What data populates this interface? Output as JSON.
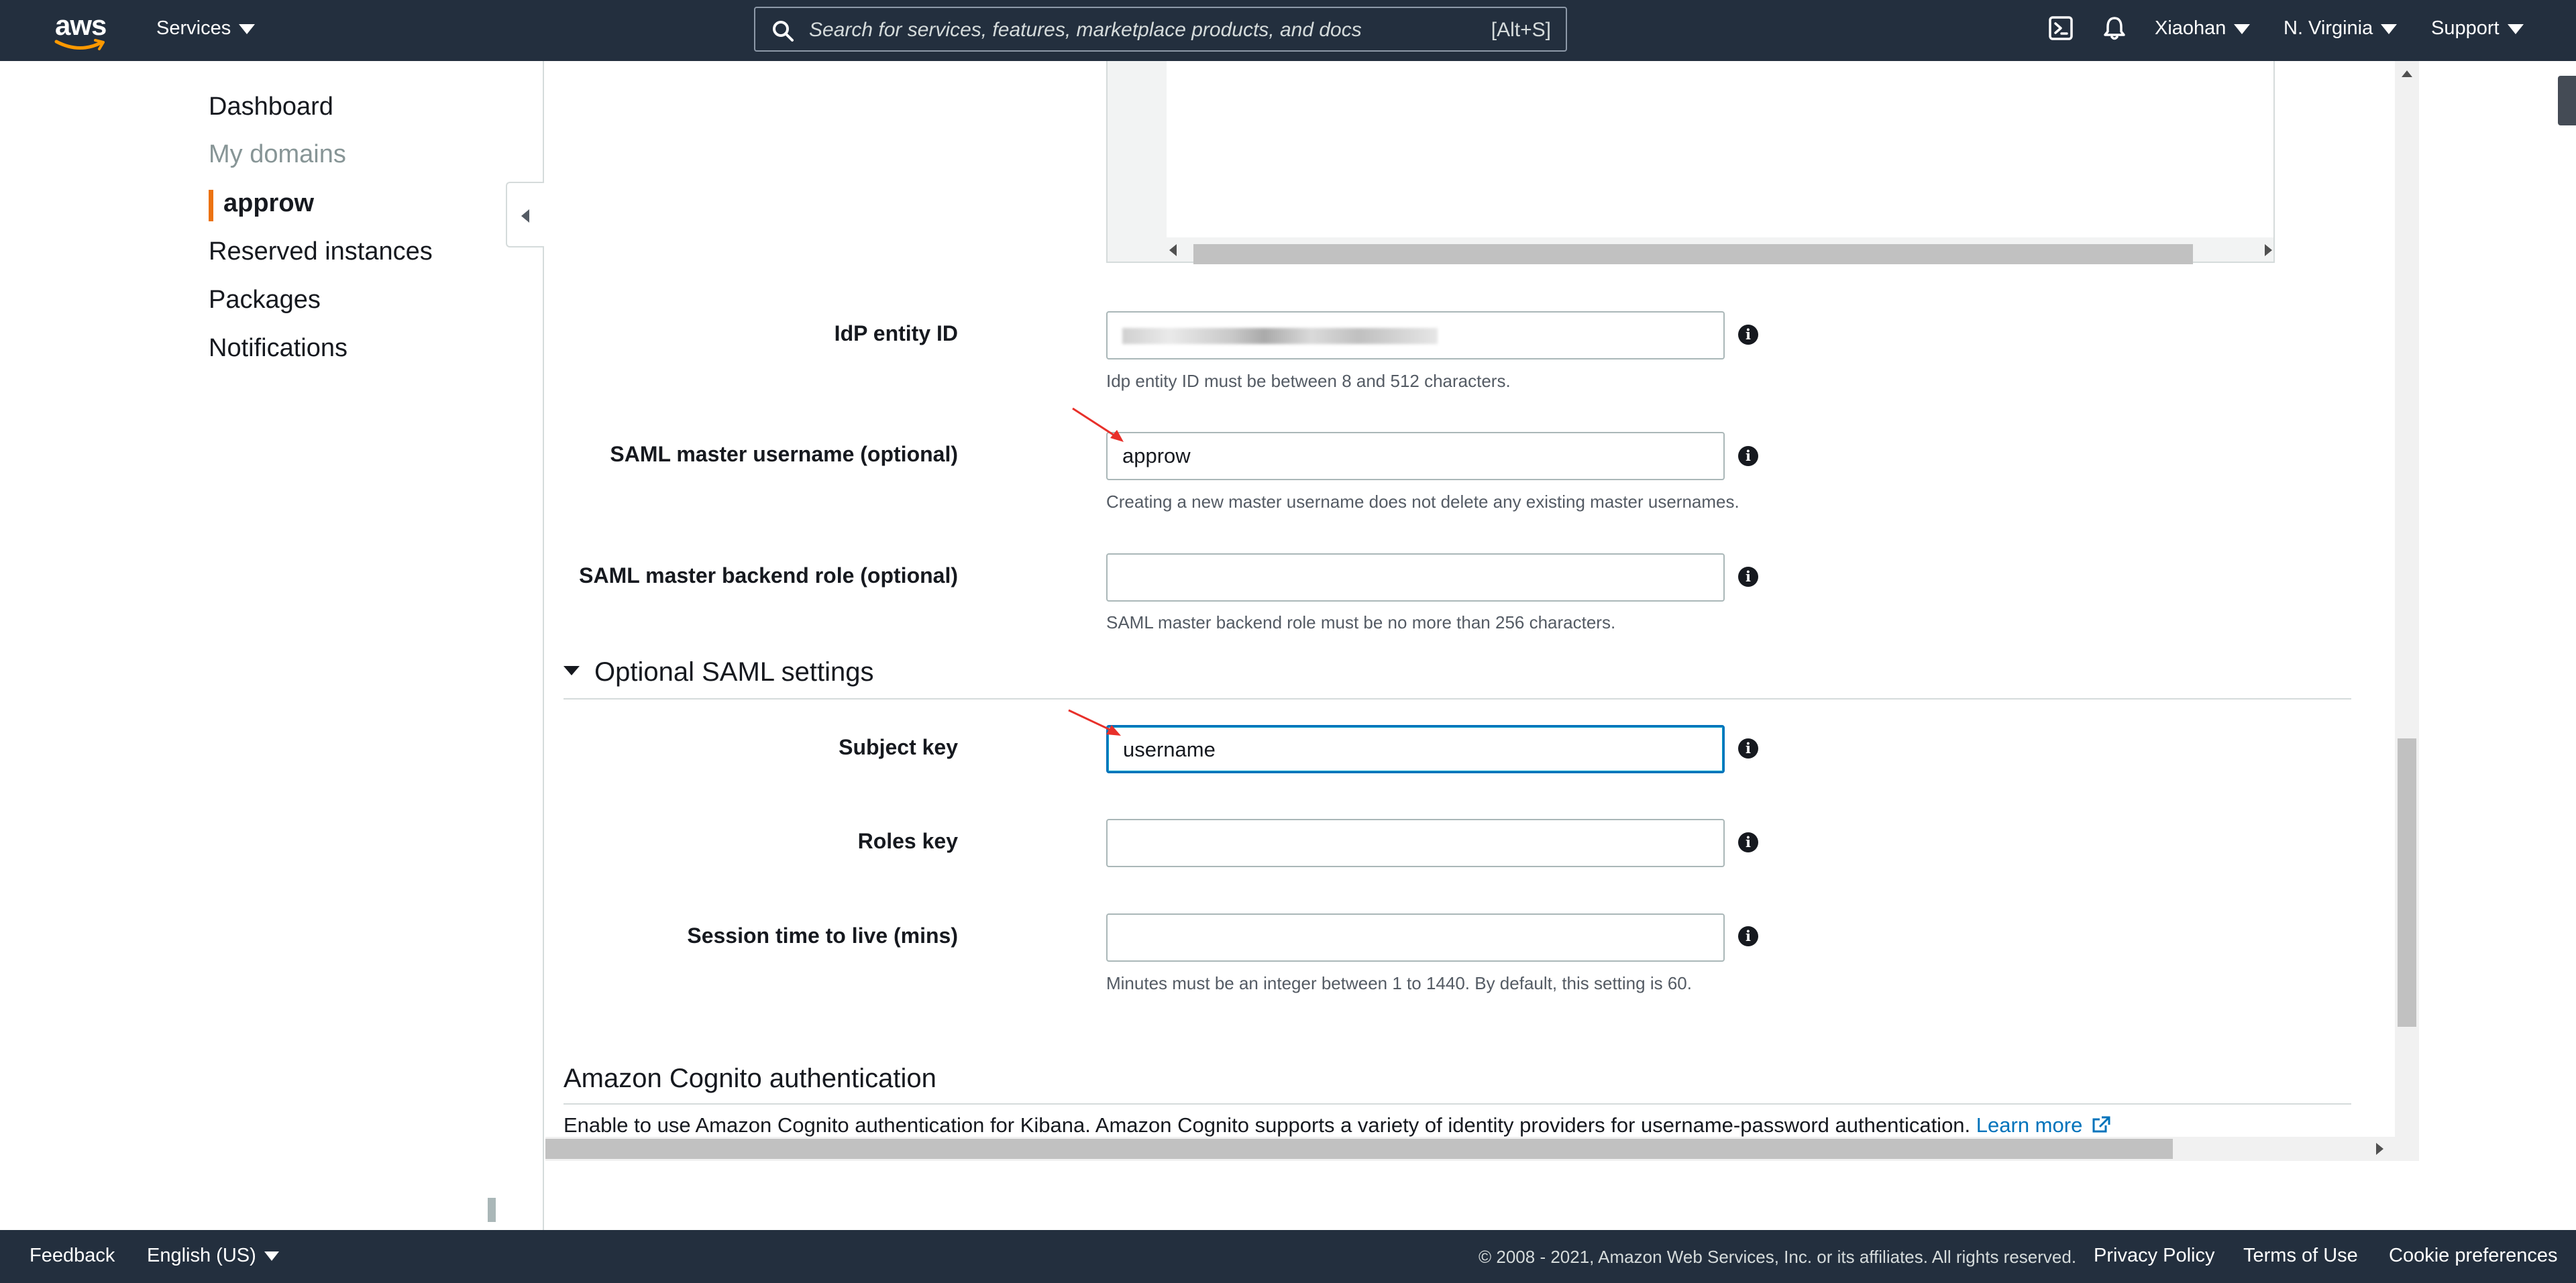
{
  "topnav": {
    "logo_text": "aws",
    "services_label": "Services",
    "search_placeholder": "Search for services, features, marketplace products, and docs",
    "search_shortcut": "[Alt+S]",
    "account_label": "Xiaohan",
    "region_label": "N. Virginia",
    "support_label": "Support"
  },
  "sidebar": {
    "items": [
      {
        "label": "Dashboard"
      },
      {
        "label": "My domains"
      },
      {
        "label": "approw"
      },
      {
        "label": "Reserved instances"
      },
      {
        "label": "Packages"
      },
      {
        "label": "Notifications"
      }
    ]
  },
  "form": {
    "idp_entity_id": {
      "label": "IdP entity ID",
      "value": "",
      "hint": "Idp entity ID must be between 8 and 512 characters."
    },
    "saml_master_username": {
      "label": "SAML master username (optional)",
      "value": "approw",
      "hint": "Creating a new master username does not delete any existing master usernames."
    },
    "saml_master_backend_role": {
      "label": "SAML master backend role (optional)",
      "value": "",
      "hint": "SAML master backend role must be no more than 256 characters."
    },
    "optional_section_title": "Optional SAML settings",
    "subject_key": {
      "label": "Subject key",
      "value": "username"
    },
    "roles_key": {
      "label": "Roles key",
      "value": ""
    },
    "session_ttl": {
      "label": "Session time to live (mins)",
      "value": "",
      "hint": "Minutes must be an integer between 1 to 1440. By default, this setting is 60."
    }
  },
  "cognito": {
    "title": "Amazon Cognito authentication",
    "text": "Enable to use Amazon Cognito authentication for Kibana. Amazon Cognito supports a variety of identity providers for username-password authentication. ",
    "learn_more": "Learn more"
  },
  "footer": {
    "feedback": "Feedback",
    "language": "English (US)",
    "copyright": "© 2008 - 2021, Amazon Web Services, Inc. or its affiliates. All rights reserved.",
    "privacy": "Privacy Policy",
    "terms": "Terms of Use",
    "cookies": "Cookie preferences"
  },
  "colors": {
    "nav_bg": "#232f3e",
    "accent_orange": "#ec7211",
    "link_blue": "#0073bb",
    "annotation_red": "#e8302a"
  }
}
